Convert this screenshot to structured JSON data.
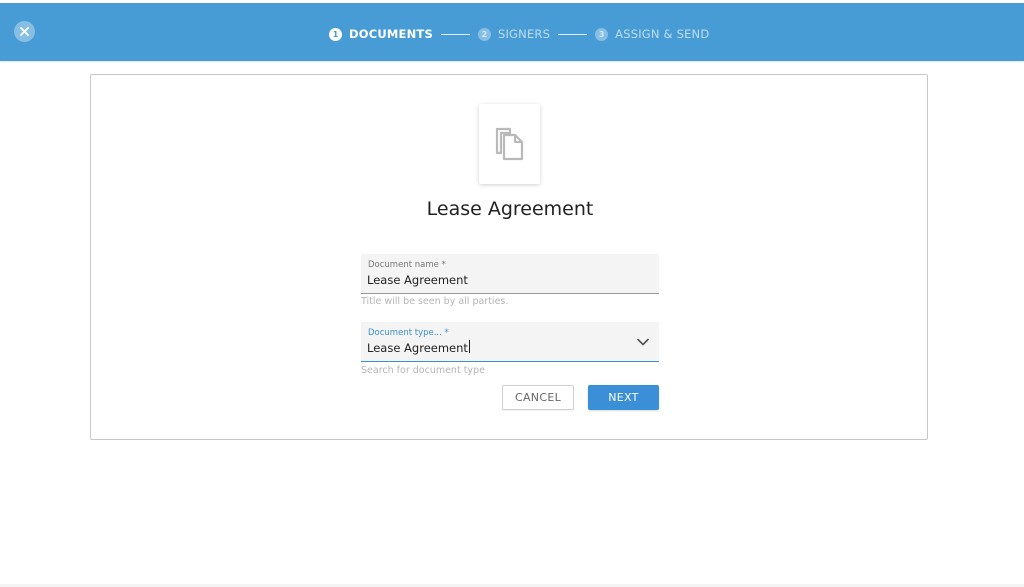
{
  "header": {
    "close_icon": "close-icon",
    "steps": [
      {
        "number": "1",
        "label": "DOCUMENTS",
        "state": "active"
      },
      {
        "number": "2",
        "label": "SIGNERS",
        "state": "inactive"
      },
      {
        "number": "3",
        "label": "ASSIGN & SEND",
        "state": "inactive"
      }
    ],
    "colors": {
      "bar": "#479cd6",
      "active_text": "#ffffff"
    }
  },
  "document": {
    "icon": "copy-document-icon",
    "title": "Lease Agreement"
  },
  "form": {
    "name_field": {
      "label": "Document name *",
      "value": "Lease Agreement",
      "helper": "Title will be seen by all parties."
    },
    "type_field": {
      "label": "Document type... *",
      "value": "Lease Agreement",
      "helper": "Search for document type",
      "icon": "chevron-down-icon"
    },
    "cancel_label": "CANCEL",
    "next_label": "NEXT",
    "accent": "#3a8fd6"
  }
}
